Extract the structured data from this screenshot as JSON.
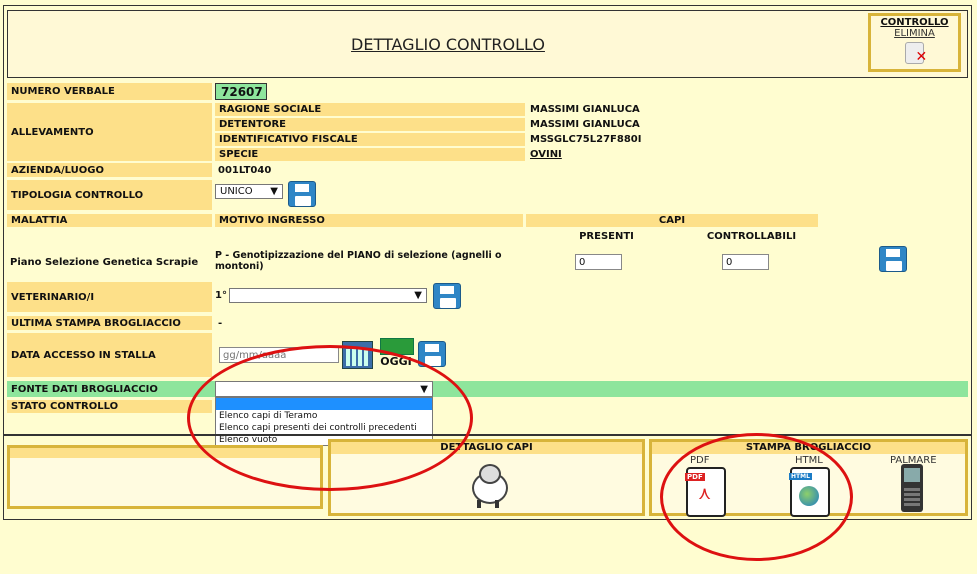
{
  "header": {
    "title": "DETTAGLIO CONTROLLO",
    "controllo_title": "CONTROLLO",
    "controllo_elimina": "ELIMINA"
  },
  "verbale": {
    "label": "NUMERO VERBALE",
    "value": "72607"
  },
  "allevamento": {
    "label": "ALLEVAMENTO",
    "rows": [
      {
        "k": "RAGIONE SOCIALE",
        "v": "MASSIMI GIANLUCA"
      },
      {
        "k": "DETENTORE",
        "v": "MASSIMI GIANLUCA"
      },
      {
        "k": "IDENTIFICATIVO FISCALE",
        "v": "MSSGLC75L27F880I"
      },
      {
        "k": "SPECIE",
        "v": "OVINI"
      }
    ]
  },
  "azienda": {
    "label": "AZIENDA/LUOGO",
    "value": "001LT040"
  },
  "tipologia": {
    "label": "TIPOLOGIA CONTROLLO",
    "value": "UNICO"
  },
  "malattia": {
    "col_malattia": "MALATTIA",
    "col_motivo": "MOTIVO INGRESSO",
    "col_capi": "CAPI",
    "col_presenti": "PRESENTI",
    "col_controllabili": "CONTROLLABILI",
    "row_malattia": "Piano Selezione Genetica Scrapie",
    "row_motivo": "P - Genotipizzazione del PIANO di selezione (agnelli o montoni)",
    "presenti": "0",
    "controllabili": "0"
  },
  "veterinario": {
    "label": "VETERINARIO/I",
    "prefix": "1°",
    "value": ""
  },
  "stampa": {
    "label": "ULTIMA STAMPA BROGLIACCIO",
    "value": "-"
  },
  "accesso": {
    "label": "DATA ACCESSO IN STALLA",
    "placeholder": "gg/mm/aaaa",
    "oggi": "OGGI"
  },
  "fonte": {
    "label": "FONTE DATI BROGLIACCIO",
    "options": [
      "Elenco capi di Teramo",
      "Elenco capi presenti dei controlli precedenti",
      "Elenco vuoto"
    ]
  },
  "stato": {
    "label": "STATO CONTROLLO"
  },
  "dettaglio_capi": {
    "title": "DETTAGLIO CAPI"
  },
  "brogliaccio": {
    "title": "STAMPA BROGLIACCIO",
    "pdf": "PDF",
    "html": "HTML",
    "palmare": "PALMARE",
    "pdf_badge": "PDF",
    "html_badge": "HTML"
  },
  "colors": {
    "label_bg": "#fde089",
    "accent_green": "#8ee59c",
    "annotation_red": "#dd1111",
    "save_blue": "#2f86c6"
  }
}
